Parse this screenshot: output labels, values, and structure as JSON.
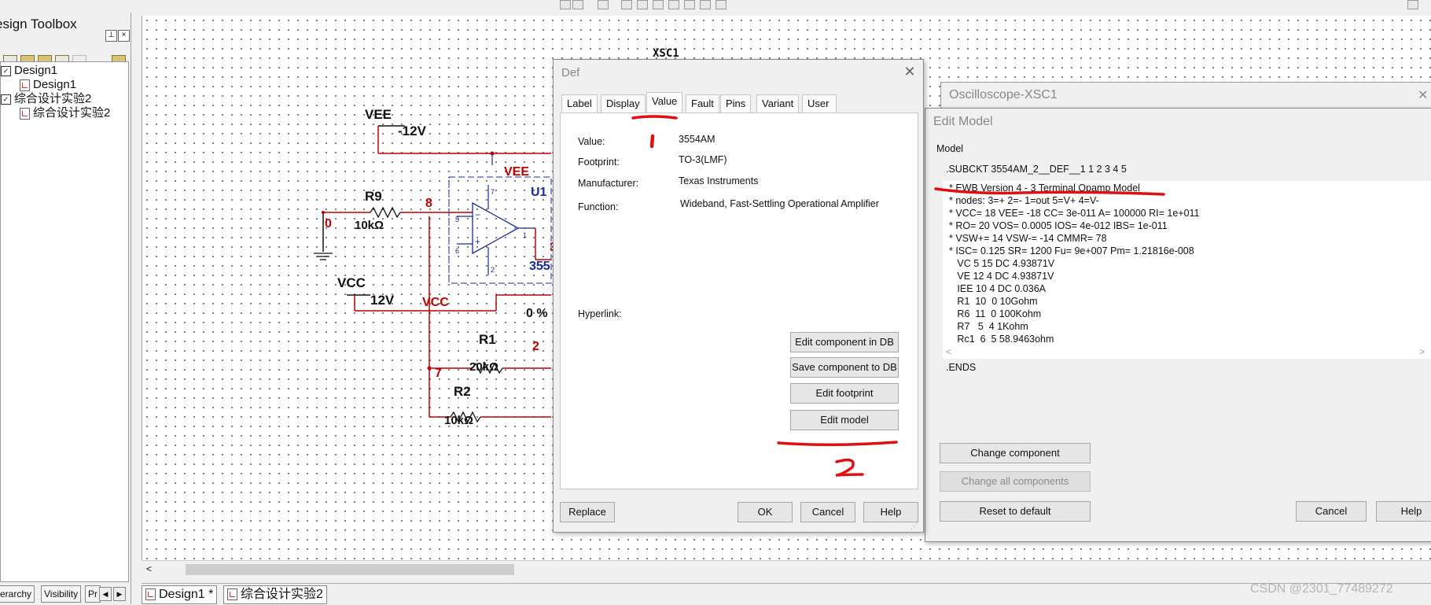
{
  "toolbox": {
    "title": "esign Toolbox",
    "tree": [
      {
        "label": "Design1",
        "type": "project",
        "indent": 0
      },
      {
        "label": "Design1",
        "type": "document",
        "indent": 1
      },
      {
        "label": "综合设计实验2",
        "type": "project",
        "indent": 0
      },
      {
        "label": "综合设计实验2",
        "type": "document",
        "indent": 1
      }
    ],
    "tabs": [
      "erarchy",
      "Visibility",
      "Pr"
    ]
  },
  "document_tabs": [
    "Design1 *",
    "综合设计实验2"
  ],
  "schematic": {
    "labels": {
      "xsc1": "XSC1",
      "vee": "VEE",
      "vee_val": "-12V",
      "vcc": "VCC",
      "vcc_val": "12V",
      "r9": "R9",
      "r9_val": "10kΩ",
      "r1": "R1",
      "r1_val": "20kΩ",
      "r2": "R2",
      "r2_val": "10kΩ",
      "u1": "U1",
      "part": "355",
      "percent": "0 %"
    },
    "nets": {
      "n0": "0",
      "n8": "8",
      "n2": "2",
      "n7": "7",
      "n3": "3",
      "vee_net": "VEE",
      "vcc_net": "VCC"
    },
    "pins": {
      "p7": "7",
      "p5": "5",
      "p6": "6",
      "p2": "2",
      "p1": "1",
      "minus": "−",
      "plus": "+"
    }
  },
  "def_dialog": {
    "title": "Def",
    "tabs": [
      "Label",
      "Display",
      "Value",
      "Fault",
      "Pins",
      "Variant",
      "User fields"
    ],
    "active_tab": "Value",
    "fields": [
      {
        "label": "Value:",
        "value": "3554AM"
      },
      {
        "label": "Footprint:",
        "value": "TO-3(LMF)"
      },
      {
        "label": "Manufacturer:",
        "value": "Texas Instruments"
      },
      {
        "label": "Function:",
        "value": "Wideband, Fast-Settling Operational Amplifier"
      }
    ],
    "hyperlink_label": "Hyperlink:",
    "side_buttons": [
      "Edit component in DB",
      "Save component to DB",
      "Edit footprint",
      "Edit model"
    ],
    "bottom_buttons": {
      "replace": "Replace",
      "ok": "OK",
      "cancel": "Cancel",
      "help": "Help"
    },
    "annotations": {
      "one": "1",
      "two": "2"
    }
  },
  "oscilloscope": {
    "title": "Oscilloscope-XSC1"
  },
  "edit_model": {
    "title": "Edit Model",
    "group_label": "Model",
    "subckt": ".SUBCKT 3554AM_2__DEF__1 1 2 3 4 5",
    "lines": [
      "* EWB Version 4 - 3 Terminal Opamp Model",
      "* nodes: 3=+ 2=- 1=out 5=V+ 4=V-",
      "* VCC= 18 VEE= -18 CC= 3e-011 A= 100000 RI= 1e+011",
      "* RO= 20 VOS= 0.0005 IOS= 4e-012 IBS= 1e-011",
      "* VSW+= 14 VSW-= -14 CMMR= 78",
      "* ISC= 0.125 SR= 1200 Fu= 9e+007 Pm= 1.21816e-008",
      "   VC 5 15 DC 4.93871V",
      "   VE 12 4 DC 4.93871V",
      "   IEE 10 4 DC 0.036A",
      "   R1  10  0 10Gohm",
      "   R6  11  0 100Kohm",
      "   R7   5  4 1Kohm",
      "   Rc1  6  5 58.9463ohm"
    ],
    "ends": ".ENDS",
    "buttons": {
      "change": "Change component",
      "change_all": "Change all components",
      "reset": "Reset to default",
      "cancel": "Cancel",
      "help": "Help"
    }
  },
  "watermark": "CSDN @2301_77489272",
  "colors": {
    "net": "#c00000",
    "wire": "#c00000",
    "component": "#1a2a9a",
    "annotation": "#e01010"
  }
}
